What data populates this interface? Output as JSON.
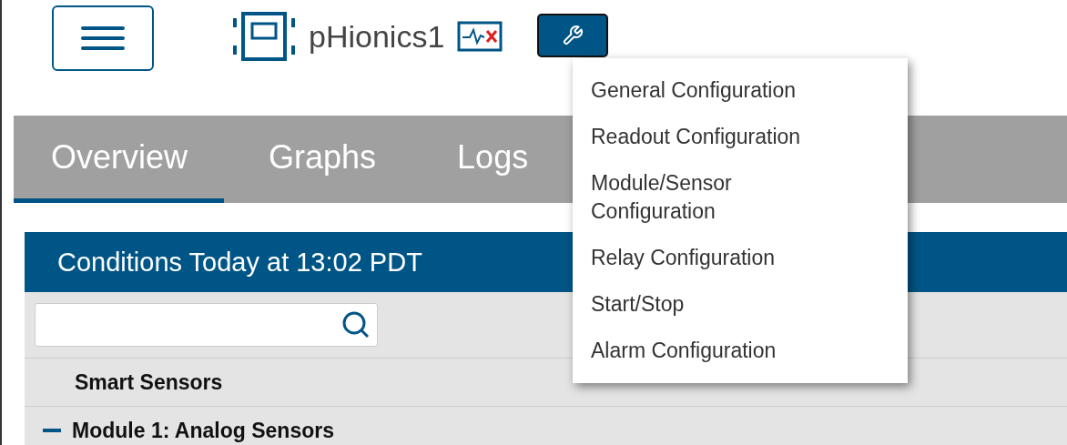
{
  "header": {
    "device_name": "pHionics1"
  },
  "tabs": [
    {
      "label": "Overview",
      "selected": true
    },
    {
      "label": "Graphs",
      "selected": false
    },
    {
      "label": "Logs",
      "selected": false
    }
  ],
  "panel": {
    "title": "Conditions Today at 13:02 PDT",
    "rows": [
      {
        "kind": "search"
      },
      {
        "label": "Smart Sensors",
        "kind": "heading"
      },
      {
        "label": "Module 1: Analog Sensors",
        "kind": "group",
        "expanded": true
      }
    ]
  },
  "config_menu": {
    "items": [
      "General Configuration",
      "Readout Configuration",
      "Module/Sensor Configuration",
      "Relay Configuration",
      "Start/Stop",
      "Alarm Configuration"
    ]
  }
}
